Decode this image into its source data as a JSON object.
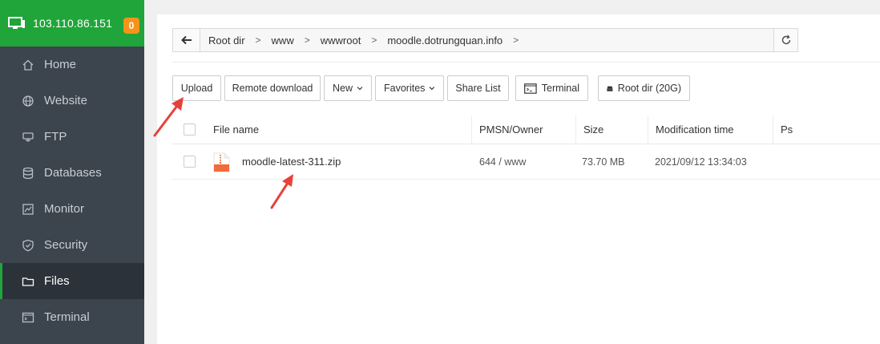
{
  "server": {
    "ip": "103.110.86.151",
    "badge": "0"
  },
  "nav": [
    {
      "label": "Home",
      "icon": "home-icon"
    },
    {
      "label": "Website",
      "icon": "globe-icon"
    },
    {
      "label": "FTP",
      "icon": "ftp-icon"
    },
    {
      "label": "Databases",
      "icon": "database-icon"
    },
    {
      "label": "Monitor",
      "icon": "monitor-icon"
    },
    {
      "label": "Security",
      "icon": "shield-icon"
    },
    {
      "label": "Files",
      "icon": "folder-icon",
      "active": true
    },
    {
      "label": "Terminal",
      "icon": "terminal-icon"
    }
  ],
  "breadcrumb": [
    "Root dir",
    "www",
    "wwwroot",
    "moodle.dotrungquan.info"
  ],
  "toolbar": {
    "upload": "Upload",
    "remote_download": "Remote download",
    "new": "New",
    "favorites": "Favorites",
    "share_list": "Share List",
    "terminal": "Terminal",
    "root_dir": "Root dir (20G)"
  },
  "table": {
    "headers": {
      "name": "File name",
      "perm": "PMSN/Owner",
      "size": "Size",
      "mod": "Modification time",
      "ps": "Ps"
    },
    "rows": [
      {
        "name": "moodle-latest-311.zip",
        "perm": "644 / www",
        "size": "73.70 MB",
        "mod": "2021/09/12 13:34:03"
      }
    ]
  },
  "colors": {
    "brand_green": "#20a53a",
    "sidebar_bg": "#3c444d",
    "badge_orange": "#f7931a",
    "annotation_red": "#e8413b"
  }
}
